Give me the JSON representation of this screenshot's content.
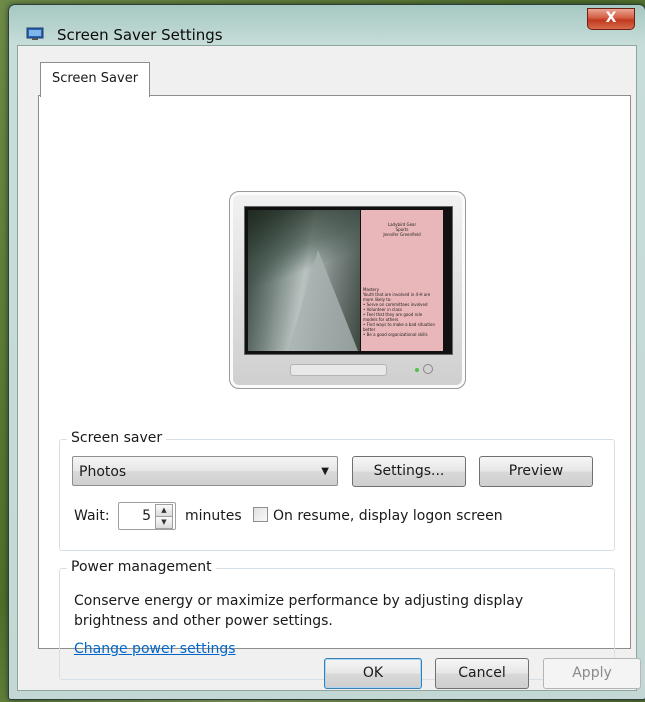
{
  "window": {
    "title": "Screen Saver Settings",
    "close_label": "X"
  },
  "tabs": [
    {
      "label": "Screen Saver"
    }
  ],
  "preview": {
    "panel_heading_lines": [
      "Ladybird Gear",
      "Sports",
      "Jennifer Greenfield"
    ],
    "panel_body_lines": [
      "Mastery",
      "Youth that are involved in 4-H are",
      "more likely to:",
      "• Serve on committees involved",
      "• Volunteer in class",
      "• Feel that they are good role",
      "models for others",
      "• Find ways to make a bad situation",
      "better",
      "• Be a good organizational skills"
    ]
  },
  "screen_saver": {
    "legend": "Screen saver",
    "selected": "Photos",
    "settings_label": "Settings...",
    "preview_label": "Preview",
    "wait_label": "Wait:",
    "wait_value": "5",
    "minutes_label": "minutes",
    "resume_label": "On resume, display logon screen",
    "resume_checked": false
  },
  "power": {
    "legend": "Power management",
    "description": "Conserve energy or maximize performance by adjusting display brightness and other power settings.",
    "link": "Change power settings"
  },
  "footer": {
    "ok": "OK",
    "cancel": "Cancel",
    "apply": "Apply"
  }
}
